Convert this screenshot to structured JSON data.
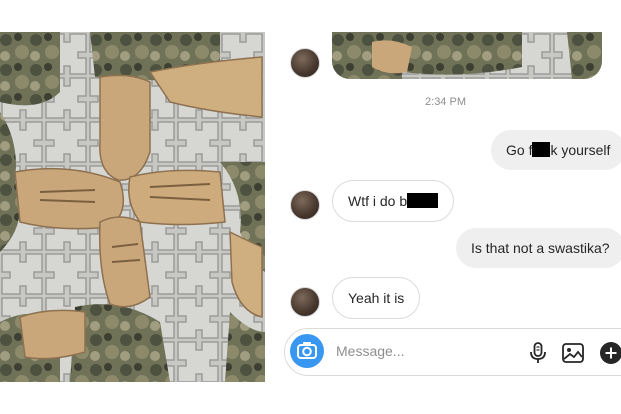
{
  "chat": {
    "timestamp": "2:34 PM",
    "messages": [
      {
        "direction": "sent",
        "before": "Go f",
        "after": "k yourself"
      },
      {
        "direction": "received",
        "before": "Wtf i do b",
        "after": ""
      },
      {
        "direction": "sent",
        "text": "Is that not a swastika?"
      },
      {
        "direction": "received",
        "text": "Yeah it is"
      }
    ]
  },
  "composer": {
    "placeholder": "Message...",
    "icons": [
      "camera-icon",
      "microphone-icon",
      "gallery-icon",
      "add-icon"
    ]
  },
  "colors": {
    "accent": "#3897f0",
    "sent_bubble": "#efefef",
    "received_border": "#dbdbdb",
    "muted_text": "#8e8e8e"
  }
}
